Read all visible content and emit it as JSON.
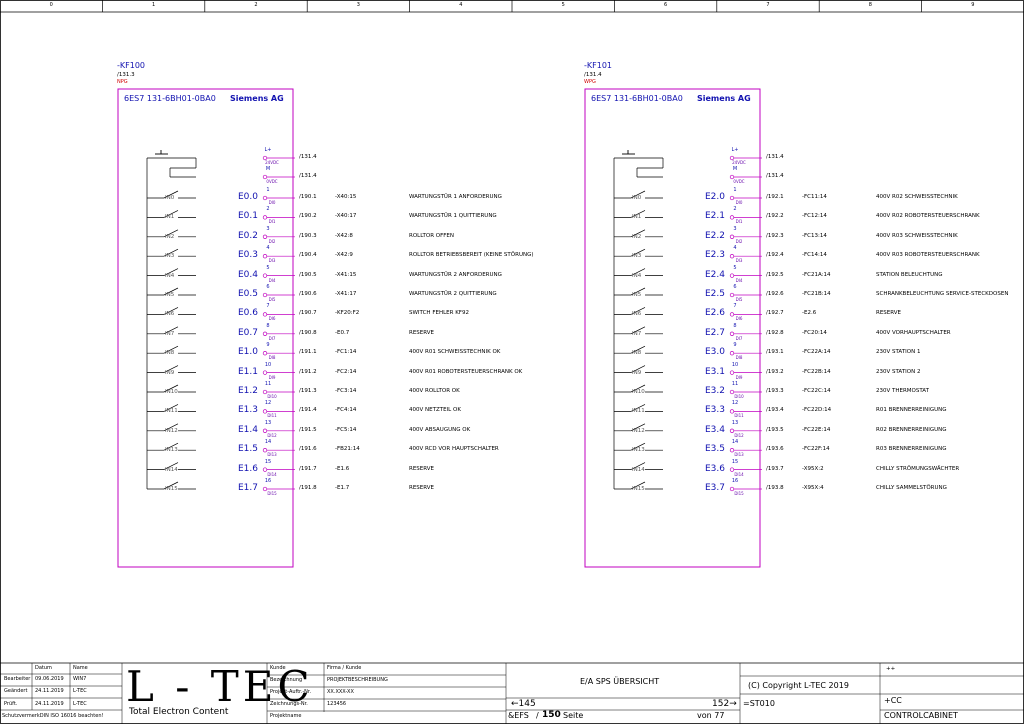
{
  "columns": [
    "0",
    "1",
    "2",
    "3",
    "4",
    "5",
    "6",
    "7",
    "8",
    "9"
  ],
  "modules": [
    {
      "tag": "-KF100",
      "ref": "/131.3",
      "sub": "NPG",
      "order_no": "6ES7 131-6BH01-0BA0",
      "maker": "Siemens AG",
      "supply": [
        {
          "top": "L+",
          "label": "24VDC",
          "ref": "/131.4"
        },
        {
          "top": "M",
          "label": "0VDC",
          "ref": "/131.4"
        }
      ],
      "rows": [
        {
          "in": "IN0",
          "addr": "E0.0",
          "pin": "1",
          "pinlbl": "DI0",
          "ref": "/190.1",
          "xref": "-X40:15",
          "text": "WARTUNGSTÜR 1 ANFORDERUNG"
        },
        {
          "in": "IN1",
          "addr": "E0.1",
          "pin": "2",
          "pinlbl": "DI1",
          "ref": "/190.2",
          "xref": "-X40:17",
          "text": "WARTUNGSTÜR 1 QUITTIERUNG"
        },
        {
          "in": "IN2",
          "addr": "E0.2",
          "pin": "3",
          "pinlbl": "DI2",
          "ref": "/190.3",
          "xref": "-X42:8",
          "text": "ROLLTOR OFFEN"
        },
        {
          "in": "IN3",
          "addr": "E0.3",
          "pin": "4",
          "pinlbl": "DI3",
          "ref": "/190.4",
          "xref": "-X42:9",
          "text": "ROLLTOR BETRIEBSBEREIT (KEINE STÖRUNG)"
        },
        {
          "in": "IN4",
          "addr": "E0.4",
          "pin": "5",
          "pinlbl": "DI4",
          "ref": "/190.5",
          "xref": "-X41:15",
          "text": "WARTUNGSTÜR 2 ANFORDERUNG"
        },
        {
          "in": "IN5",
          "addr": "E0.5",
          "pin": "6",
          "pinlbl": "DI5",
          "ref": "/190.6",
          "xref": "-X41:17",
          "text": "WARTUNGSTÜR 2 QUITTIERUNG"
        },
        {
          "in": "IN6",
          "addr": "E0.6",
          "pin": "7",
          "pinlbl": "DI6",
          "ref": "/190.7",
          "xref": "-KF20:F2",
          "text": "SWITCH FEHLER KF92"
        },
        {
          "in": "IN7",
          "addr": "E0.7",
          "pin": "8",
          "pinlbl": "DI7",
          "ref": "/190.8",
          "xref": "-E0.7",
          "text": "RESERVE"
        },
        {
          "in": "IN8",
          "addr": "E1.0",
          "pin": "9",
          "pinlbl": "DI8",
          "ref": "/191.1",
          "xref": "-FC1:14",
          "text": "400V R01 SCHWEISSTECHNIK OK"
        },
        {
          "in": "IN9",
          "addr": "E1.1",
          "pin": "10",
          "pinlbl": "DI9",
          "ref": "/191.2",
          "xref": "-FC2:14",
          "text": "400V R01 ROBOTERSTEUERSCHRANK OK"
        },
        {
          "in": "IN10",
          "addr": "E1.2",
          "pin": "11",
          "pinlbl": "DI10",
          "ref": "/191.3",
          "xref": "-FC3:14",
          "text": "400V ROLLTOR OK"
        },
        {
          "in": "IN11",
          "addr": "E1.3",
          "pin": "12",
          "pinlbl": "DI11",
          "ref": "/191.4",
          "xref": "-FC4:14",
          "text": "400V NETZTEIL OK"
        },
        {
          "in": "IN12",
          "addr": "E1.4",
          "pin": "13",
          "pinlbl": "DI12",
          "ref": "/191.5",
          "xref": "-FC5:14",
          "text": "400V ABSAUGUNG OK"
        },
        {
          "in": "IN13",
          "addr": "E1.5",
          "pin": "14",
          "pinlbl": "DI13",
          "ref": "/191.6",
          "xref": "-FB21:14",
          "text": "400V RCD VOR HAUPTSCHALTER"
        },
        {
          "in": "IN14",
          "addr": "E1.6",
          "pin": "15",
          "pinlbl": "DI14",
          "ref": "/191.7",
          "xref": "-E1.6",
          "text": "RESERVE"
        },
        {
          "in": "IN15",
          "addr": "E1.7",
          "pin": "16",
          "pinlbl": "DI15",
          "ref": "/191.8",
          "xref": "-E1.7",
          "text": "RESERVE"
        }
      ]
    },
    {
      "tag": "-KF101",
      "ref": "/131.4",
      "sub": "WPG",
      "order_no": "6ES7 131-6BH01-0BA0",
      "maker": "Siemens AG",
      "supply": [
        {
          "top": "L+",
          "label": "24VDC",
          "ref": "/131.4"
        },
        {
          "top": "M",
          "label": "0VDC",
          "ref": "/131.4"
        }
      ],
      "rows": [
        {
          "in": "IN0",
          "addr": "E2.0",
          "pin": "1",
          "pinlbl": "DI0",
          "ref": "/192.1",
          "xref": "-FC11:14",
          "text": "400V R02 SCHWEISSTECHNIK"
        },
        {
          "in": "IN1",
          "addr": "E2.1",
          "pin": "2",
          "pinlbl": "DI1",
          "ref": "/192.2",
          "xref": "-FC12:14",
          "text": "400V R02 ROBOTERSTEUERSCHRANK"
        },
        {
          "in": "IN2",
          "addr": "E2.2",
          "pin": "3",
          "pinlbl": "DI2",
          "ref": "/192.3",
          "xref": "-FC13:14",
          "text": "400V R03 SCHWEISSTECHNIK"
        },
        {
          "in": "IN3",
          "addr": "E2.3",
          "pin": "4",
          "pinlbl": "DI3",
          "ref": "/192.4",
          "xref": "-FC14:14",
          "text": "400V R03 ROBOTERSTEUERSCHRANK"
        },
        {
          "in": "IN4",
          "addr": "E2.4",
          "pin": "5",
          "pinlbl": "DI4",
          "ref": "/192.5",
          "xref": "-FC21A:14",
          "text": "STATION BELEUCHTUNG"
        },
        {
          "in": "IN5",
          "addr": "E2.5",
          "pin": "6",
          "pinlbl": "DI5",
          "ref": "/192.6",
          "xref": "-FC21B:14",
          "text": "SCHRANKBELEUCHTUNG SERVICE-STECKDOSEN"
        },
        {
          "in": "IN6",
          "addr": "E2.6",
          "pin": "7",
          "pinlbl": "DI6",
          "ref": "/192.7",
          "xref": "-E2.6",
          "text": "RESERVE"
        },
        {
          "in": "IN7",
          "addr": "E2.7",
          "pin": "8",
          "pinlbl": "DI7",
          "ref": "/192.8",
          "xref": "-FC20:14",
          "text": "400V VORHAUPTSCHALTER"
        },
        {
          "in": "IN8",
          "addr": "E3.0",
          "pin": "9",
          "pinlbl": "DI8",
          "ref": "/193.1",
          "xref": "-FC22A:14",
          "text": "230V STATION 1"
        },
        {
          "in": "IN9",
          "addr": "E3.1",
          "pin": "10",
          "pinlbl": "DI9",
          "ref": "/193.2",
          "xref": "-FC22B:14",
          "text": "230V STATION 2"
        },
        {
          "in": "IN10",
          "addr": "E3.2",
          "pin": "11",
          "pinlbl": "DI10",
          "ref": "/193.3",
          "xref": "-FC22C:14",
          "text": "230V THERMOSTAT"
        },
        {
          "in": "IN11",
          "addr": "E3.3",
          "pin": "12",
          "pinlbl": "DI11",
          "ref": "/193.4",
          "xref": "-FC22D:14",
          "text": "R01 BRENNERREINIGUNG"
        },
        {
          "in": "IN12",
          "addr": "E3.4",
          "pin": "13",
          "pinlbl": "DI12",
          "ref": "/193.5",
          "xref": "-FC22E:14",
          "text": "R02 BRENNERREINIGUNG"
        },
        {
          "in": "IN13",
          "addr": "E3.5",
          "pin": "14",
          "pinlbl": "DI13",
          "ref": "/193.6",
          "xref": "-FC22F:14",
          "text": "R03 BRENNERREINIGUNG"
        },
        {
          "in": "IN14",
          "addr": "E3.6",
          "pin": "15",
          "pinlbl": "DI14",
          "ref": "/193.7",
          "xref": "-X95X:2",
          "text": "CHILLY STRÖMUNGSWÄCHTER"
        },
        {
          "in": "IN15",
          "addr": "E3.7",
          "pin": "16",
          "pinlbl": "DI15",
          "ref": "/193.8",
          "xref": "-X95X:4",
          "text": "CHILLY SAMMELSTÖRUNG"
        }
      ]
    }
  ],
  "title_block": {
    "hdr_datum": "Datum",
    "hdr_name": "Name",
    "rows": [
      {
        "label": "Bearbeiter",
        "date": "09.06.2019",
        "name": "WIN7"
      },
      {
        "label": "Geändert",
        "date": "24.11.2019",
        "name": "L-TEC"
      },
      {
        "label": "Prüft.",
        "date": "24.11.2019",
        "name": "L-TEC"
      }
    ],
    "protection_note": "SchutzvermerkDIN ISO 16016 beachten!",
    "logo": "L - TEC",
    "logo_sub": "Total Electron Content",
    "fields": [
      {
        "label": "Kunde",
        "value": "Firma / Kunde"
      },
      {
        "label": "Bezeichnung",
        "value": "PROJEKTBESCHREIBUNG"
      },
      {
        "label": "Projekt-Auftr.-Nr.",
        "value": "XX.XXX-XX"
      },
      {
        "label": "Zeichnungs-Nr.",
        "value": "123456"
      },
      {
        "label": "Projektname",
        "value": ""
      }
    ],
    "sheet_title": "E/A SPS ÜBERSICHT",
    "prev_page": "145",
    "next_page": "152",
    "plus_plus": "++",
    "copyright": "(C) Copyright L-TEC  2019",
    "equals": "=ST010",
    "plus_cc": "+CC",
    "ampersand": "&EFS",
    "page_no": "150",
    "page_word": "Seite",
    "total": "von 77",
    "location": "CONTROLCABINET",
    "colors": {
      "module_frame": "#c000c0",
      "text_blue": "#1212b0",
      "sub_red": "#d00000"
    }
  }
}
